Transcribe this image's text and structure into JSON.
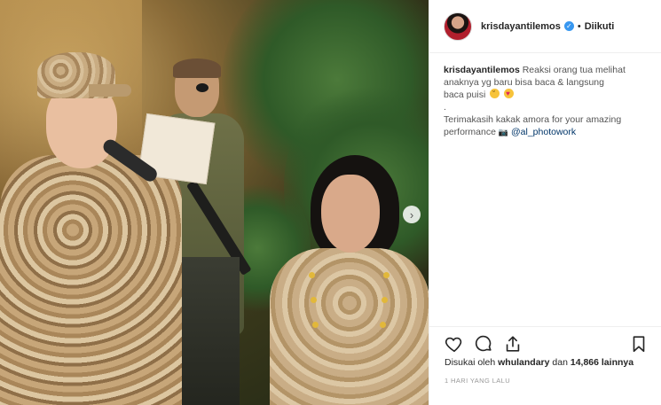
{
  "post": {
    "media": {
      "description_alt": "",
      "next_arrow": "›"
    },
    "header": {
      "username": "krisdayantilemos",
      "verified_icon": "verified-badge-icon",
      "separator": "•",
      "follow_state": "Diikuti"
    },
    "caption": {
      "username": "krisdayantilemos",
      "line1": "Reaksi orang tua melihat",
      "line2": "anaknya yg baru bisa baca & langsung",
      "line3": "baca puisi",
      "line4": ".",
      "line5": "Terimakasih kakak amora for your amazing",
      "line6_text": "performance",
      "line6_mention": "@al_photowork"
    },
    "actions": {
      "like_icon": "heart-icon",
      "comment_icon": "comment-icon",
      "share_icon": "share-icon",
      "save_icon": "bookmark-icon"
    },
    "likes": {
      "prefix": "Disukai oleh",
      "user": "whulandary",
      "connector": "dan",
      "count": "14,866 lainnya"
    },
    "timestamp": "1 HARI YANG LALU"
  },
  "colors": {
    "verified": "#3897f0",
    "mention": "#003569",
    "border": "#efefef",
    "muted": "#999999"
  }
}
